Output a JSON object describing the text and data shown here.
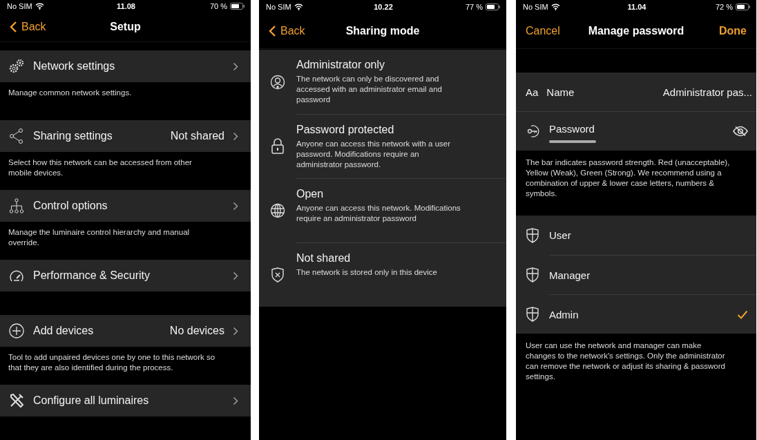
{
  "screens": [
    {
      "kind": "setup",
      "status_bar": {
        "carrier": "No SIM",
        "time": "11.08",
        "battery": "70 %"
      },
      "nav": {
        "back": "Back",
        "title": "Setup"
      },
      "sections": [
        {
          "title": "Network settings",
          "description": "Manage common network settings."
        },
        {
          "title": "Sharing settings",
          "value": "Not shared",
          "description": "Select how this network can be accessed from other mobile devices."
        },
        {
          "title": "Control options",
          "description": "Manage the luminaire control hierarchy and manual override."
        },
        {
          "title": "Performance & Security"
        },
        {
          "title": "Add devices",
          "value": "No devices",
          "description": "Tool to add unpaired devices one by one to this network so that they are also identified during the process."
        },
        {
          "title": "Configure all luminaires"
        }
      ]
    },
    {
      "kind": "sharing",
      "status_bar": {
        "carrier": "No SIM",
        "time": "10.22",
        "battery": "77 %"
      },
      "nav": {
        "back": "Back",
        "title": "Sharing mode"
      },
      "modes": [
        {
          "title": "Administrator only",
          "description": "The network can only be discovered and accessed with an administrator email and password"
        },
        {
          "title": "Password protected",
          "description": "Anyone can access this network with a user password. Modifications require an administrator password."
        },
        {
          "title": "Open",
          "description": "Anyone can access this network. Modifications require an administrator password"
        },
        {
          "title": "Not shared",
          "description": "The network is stored only in this device"
        }
      ]
    },
    {
      "kind": "password",
      "status_bar": {
        "carrier": "No SIM",
        "time": "11.04",
        "battery": "72 %"
      },
      "nav": {
        "cancel": "Cancel",
        "title": "Manage password",
        "done": "Done"
      },
      "name_field": {
        "prefix": "Aa",
        "label": "Name",
        "value": "Administrator pas..."
      },
      "password_field": {
        "label": "Password"
      },
      "strength_note": "The bar indicates password strength. Red (unacceptable), Yellow (Weak), Green (Strong). We recommend using a combination of upper & lower case letters, numbers & symbols.",
      "roles": [
        {
          "label": "User",
          "selected": false
        },
        {
          "label": "Manager",
          "selected": false
        },
        {
          "label": "Admin",
          "selected": true
        }
      ],
      "roles_note": "User can use the network and manager can make changes to the network's settings. Only the administrator can remove the network or adjust its sharing & password settings."
    }
  ]
}
